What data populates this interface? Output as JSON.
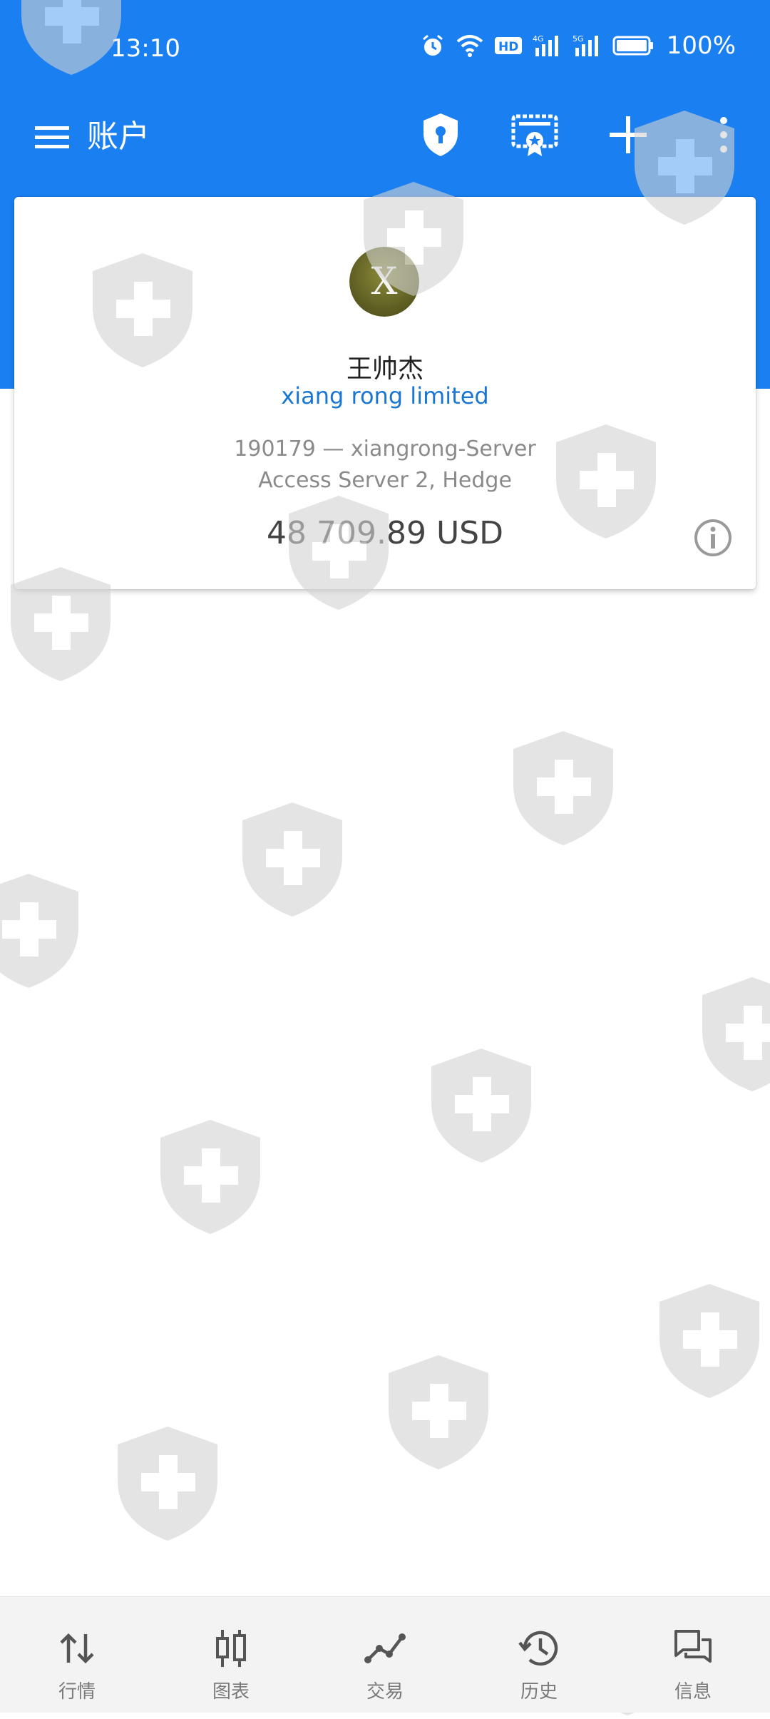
{
  "status_bar": {
    "time": "13:10",
    "battery_percent": "100%",
    "icons": [
      "alarm-icon",
      "wifi-icon",
      "hd-icon",
      "4g-signal-icon",
      "5g-signal-icon",
      "battery-icon"
    ]
  },
  "app_bar": {
    "title": "账户",
    "menu_icon": "hamburger-menu-icon",
    "actions": [
      "shield-keyhole-icon",
      "certificate-icon",
      "add-icon",
      "more-vertical-icon"
    ]
  },
  "account": {
    "avatar_letter": "X",
    "name": "王帅杰",
    "company": "xiang rong limited",
    "server_line": "190179 — xiangrong-Server",
    "type_line": "Access Server 2, Hedge",
    "balance": "48 709.89 USD"
  },
  "bottom_nav": {
    "items": [
      {
        "label": "行情",
        "icon": "quotes-arrows-icon"
      },
      {
        "label": "图表",
        "icon": "candlestick-chart-icon"
      },
      {
        "label": "交易",
        "icon": "trade-line-icon"
      },
      {
        "label": "历史",
        "icon": "history-clock-icon"
      },
      {
        "label": "信息",
        "icon": "messages-icon"
      }
    ]
  },
  "colors": {
    "primary": "#1a7ff0",
    "link": "#1976d2",
    "watermark": "#d3d3d3"
  }
}
